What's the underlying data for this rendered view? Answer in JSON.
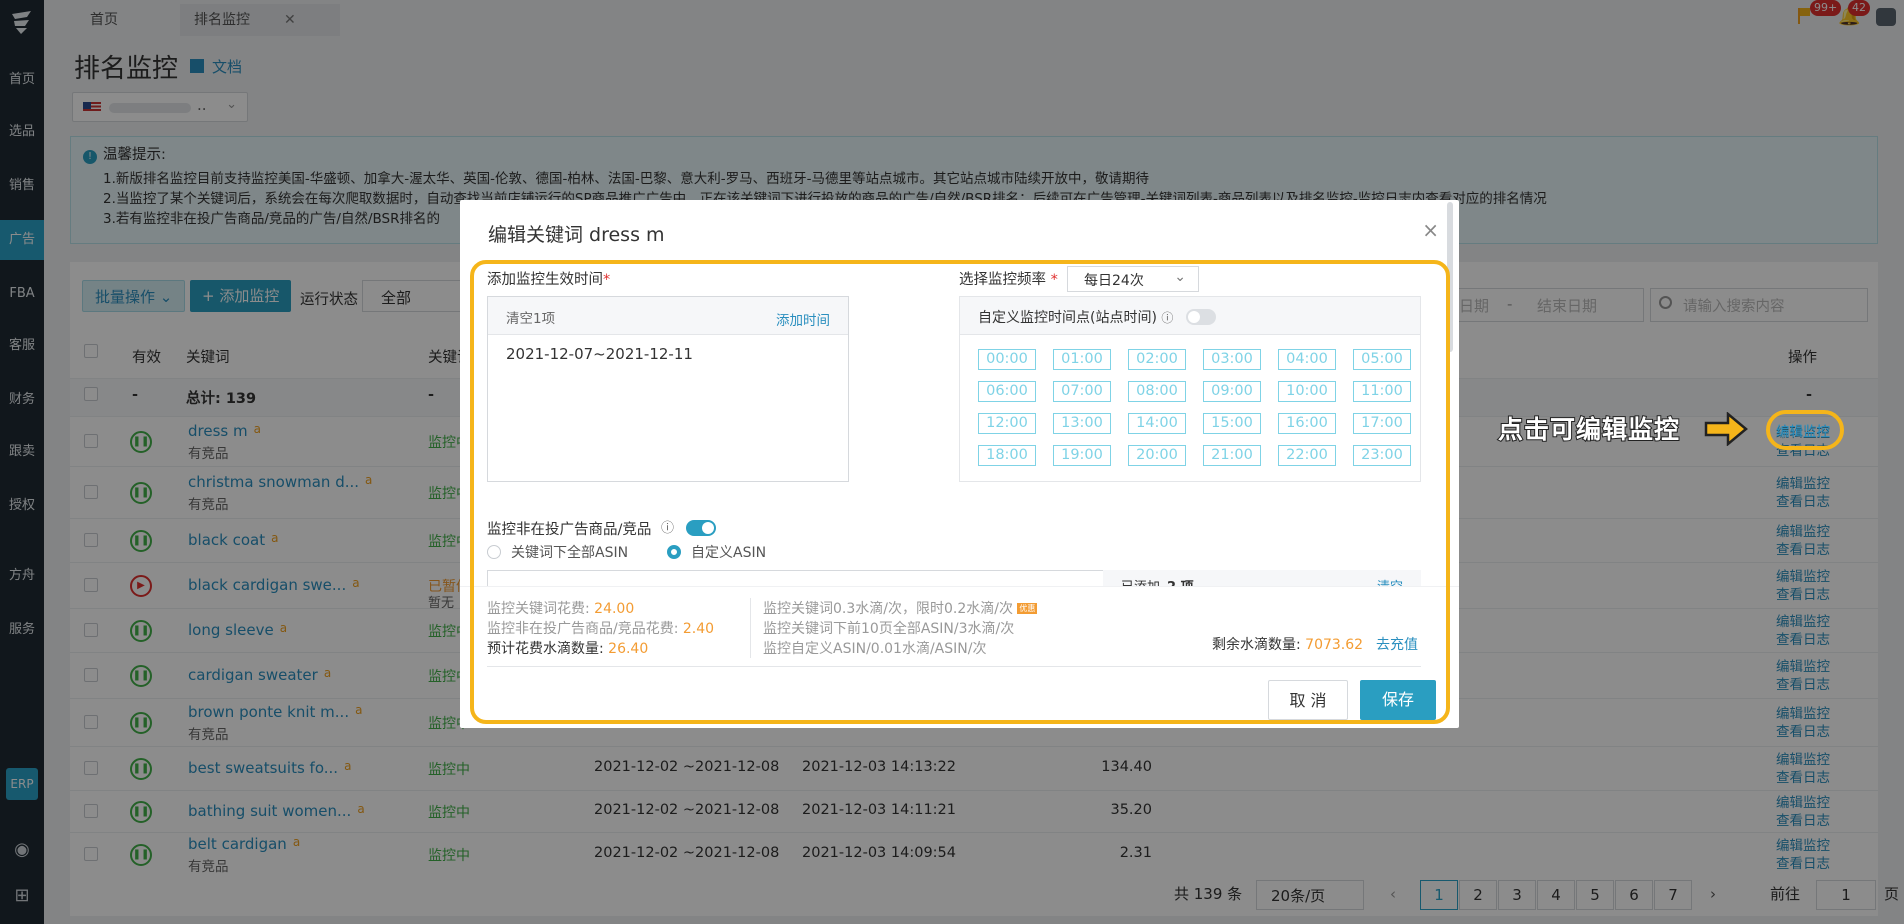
{
  "sidebar": {
    "items": [
      {
        "label": "首页"
      },
      {
        "label": "选品"
      },
      {
        "label": "销售"
      },
      {
        "label": "广告"
      },
      {
        "label": "FBA"
      },
      {
        "label": "客服"
      },
      {
        "label": "财务"
      },
      {
        "label": "跟卖"
      },
      {
        "label": "授权"
      },
      {
        "label": "方舟"
      },
      {
        "label": "服务"
      }
    ],
    "erp": "ERP"
  },
  "tabs": [
    {
      "label": "首页"
    },
    {
      "label": "排名监控"
    }
  ],
  "tab_close": "✕",
  "top_badges": {
    "notice": "99+",
    "bell": "42"
  },
  "page": {
    "title": "排名监控",
    "doc_link": "文档",
    "store_select": ".."
  },
  "alert": {
    "heading": "温馨提示:",
    "lines": [
      "1.新版排名监控目前支持监控美国-华盛顿、加拿大-渥太华、英国-伦敦、德国-柏林、法国-巴黎、意大利-罗马、西班牙-马德里等站点城市。其它站点城市陆续开放中，敬请期待",
      "2.当监控了某个关键词后，系统会在每次爬取数据时，自动查找当前店铺运行的SP商品推广广告中，正在该关键词下进行投放的商品的广告/自然/BSR排名；后续可在广告管理-关键词列表-商品列表以及排名监控-监控日志内查看对应的排名情况",
      "3.若有监控非在投广告商品/竞品的广告/自然/BSR排名的"
    ]
  },
  "toolbar": {
    "batch": "批量操作",
    "add": "+ 添加监控",
    "status_label": "运行状态",
    "status_value": "全部",
    "date_end": "结束日期",
    "date_start": "日期",
    "date_sep": "-",
    "search_placeholder": "请输入搜索内容"
  },
  "table": {
    "headers": {
      "valid": "有效",
      "keyword": "关键词",
      "kw2": "关键词",
      "ops": "操作"
    },
    "total_row": {
      "dash1": "-",
      "total": "总计: 139",
      "dash2": "-",
      "dash3": "-"
    },
    "rows": [
      {
        "keyword": "dress m",
        "sub": "有竞品",
        "status": "监控中",
        "range": "",
        "time": "",
        "value": "",
        "paused": false
      },
      {
        "keyword": "christma snowman d...",
        "sub": "有竞品",
        "status": "监控中",
        "range": "",
        "time": "",
        "value": "",
        "paused": false
      },
      {
        "keyword": "black coat",
        "sub": "",
        "status": "监控中",
        "range": "",
        "time": "",
        "value": "",
        "paused": false
      },
      {
        "keyword": "black cardigan swe...",
        "sub": "",
        "status": "已暂停",
        "status2": "暂无",
        "range": "",
        "time": "",
        "value": "",
        "paused": true
      },
      {
        "keyword": "long sleeve",
        "sub": "",
        "status": "监控中",
        "range": "",
        "time": "",
        "value": "",
        "paused": false
      },
      {
        "keyword": "cardigan sweater",
        "sub": "",
        "status": "监控中",
        "range": "",
        "time": "",
        "value": "",
        "paused": false
      },
      {
        "keyword": "brown ponte knit m...",
        "sub": "有竞品",
        "status": "监控中",
        "range": "",
        "time": "",
        "value": "",
        "paused": false
      },
      {
        "keyword": "best sweatsuits fo...",
        "sub": "",
        "status": "监控中",
        "range": "2021-12-02 ~2021-12-08",
        "time": "2021-12-03 14:13:22",
        "value": "134.40",
        "paused": false
      },
      {
        "keyword": "bathing suit women...",
        "sub": "",
        "status": "监控中",
        "range": "2021-12-02 ~2021-12-08",
        "time": "2021-12-03 14:11:21",
        "value": "35.20",
        "paused": false
      },
      {
        "keyword": "belt cardigan",
        "sub": "有竞品",
        "status": "监控中",
        "range": "2021-12-02 ~2021-12-08",
        "time": "2021-12-03 14:09:54",
        "value": "2.31",
        "paused": false
      }
    ],
    "op_edit": "编辑监控",
    "op_log": "查看日志",
    "amazon_mark": "a"
  },
  "pagination": {
    "total": "共 139 条",
    "per_page": "20条/页",
    "pages": [
      "1",
      "2",
      "3",
      "4",
      "5",
      "6",
      "7"
    ],
    "goto_label": "前往",
    "goto_value": "1",
    "goto_unit": "页",
    "prev": "‹",
    "next": "›"
  },
  "modal": {
    "title": "编辑关键词 dress m",
    "close": "×",
    "effective_label": "添加监控生效时间",
    "clear_label": "清空1项",
    "add_time": "添加时间",
    "date_range": "2021-12-07~2021-12-11",
    "freq_label": "选择监控频率",
    "freq_value": "每日24次",
    "custom_label": "自定义监控时间点(站点时间)",
    "hours": [
      "00:00",
      "01:00",
      "02:00",
      "03:00",
      "04:00",
      "05:00",
      "06:00",
      "07:00",
      "08:00",
      "09:00",
      "10:00",
      "11:00",
      "12:00",
      "13:00",
      "14:00",
      "15:00",
      "16:00",
      "17:00",
      "18:00",
      "19:00",
      "20:00",
      "21:00",
      "22:00",
      "23:00"
    ],
    "non_ad_label": "监控非在投广告商品/竞品",
    "opt_all": "关键词下全部ASIN",
    "opt_custom": "自定义ASIN",
    "added_label": "已添加",
    "added_count": "2 项",
    "clear_short": "清空",
    "cost_kw_label": "监控关键词花费:",
    "cost_kw": "24.00",
    "cost_non_label": "监控非在投广告商品/竞品花费:",
    "cost_non": "2.40",
    "cost_est_label": "预计花费水滴数量:",
    "cost_est": "26.40",
    "rule1": "监控关键词0.3水滴/次，限时0.2水滴/次",
    "rule_badge": "优惠",
    "rule2": "监控关键词下前10页全部ASIN/3水滴/次",
    "rule3": "监控自定义ASIN/0.01水滴/ASIN/次",
    "balance_label": "剩余水滴数量:",
    "balance": "7073.62",
    "recharge": "去充值",
    "cancel": "取 消",
    "save": "保存"
  },
  "callout": "点击可编辑监控",
  "colors": {
    "accent": "#2aa3c8",
    "highlight": "#f5b51a",
    "green": "#43b14a",
    "orange": "#f39c33"
  }
}
